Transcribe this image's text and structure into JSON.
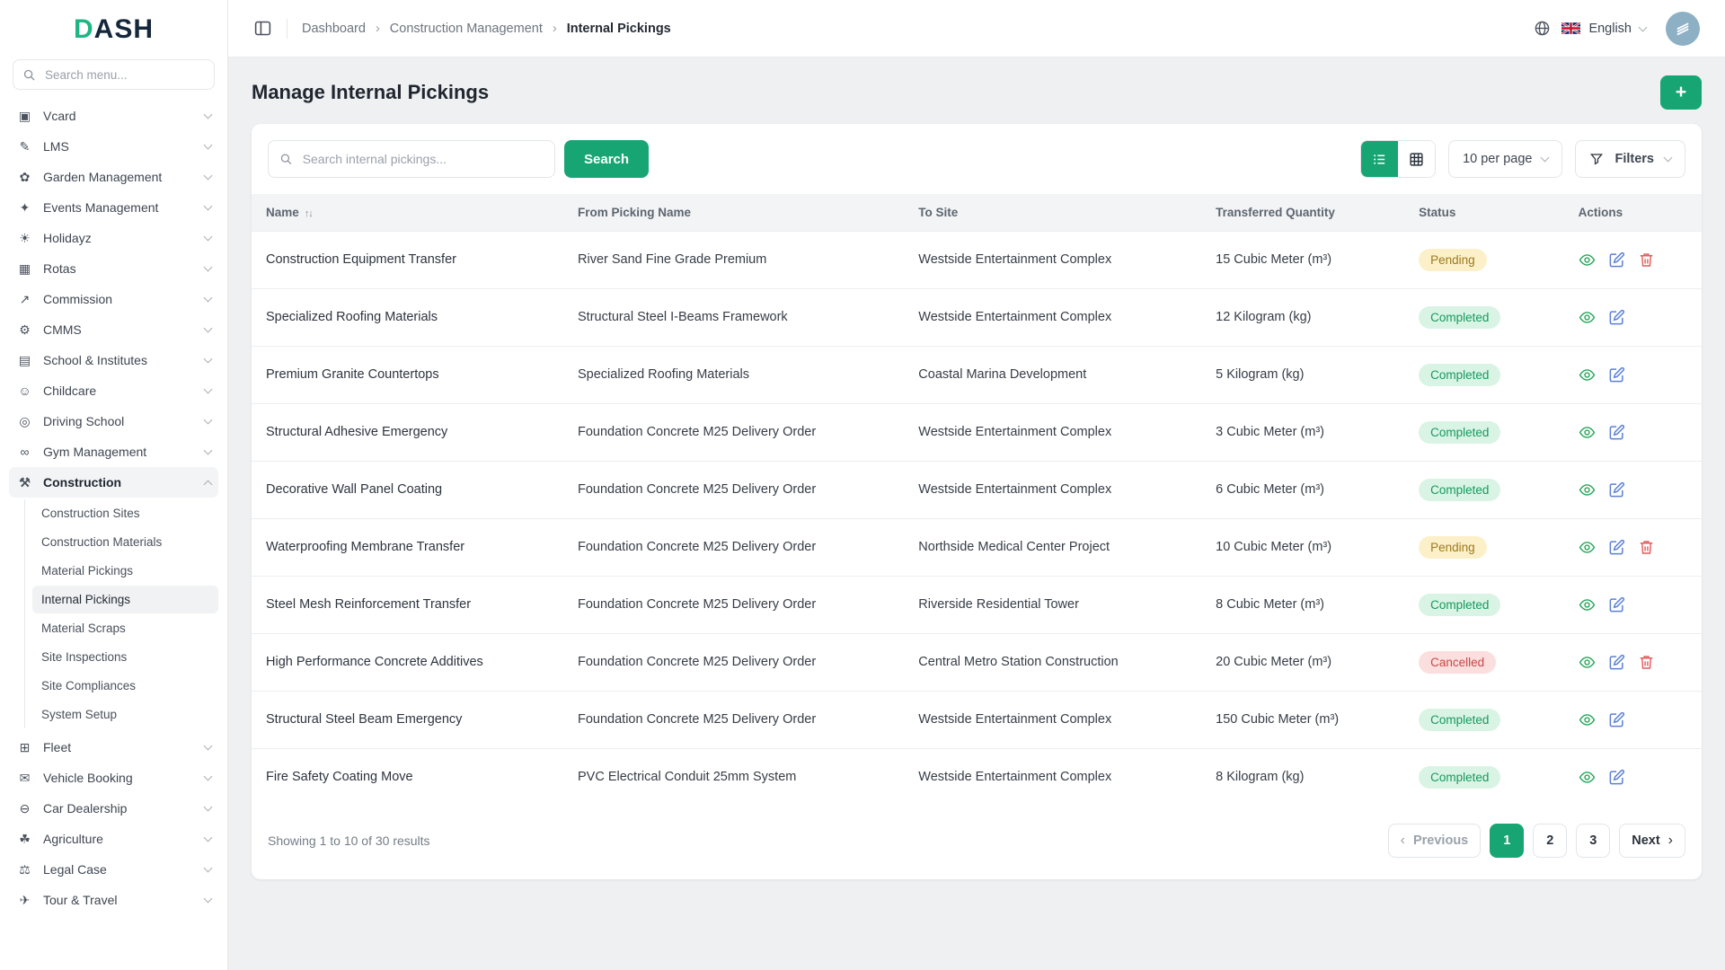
{
  "accent": "#17a673",
  "app": {
    "logo_first": "D",
    "logo_rest": "ASH"
  },
  "sidebar": {
    "search_placeholder": "Search menu...",
    "items": [
      {
        "label": "Vcard",
        "icon": "▣"
      },
      {
        "label": "LMS",
        "icon": "✎"
      },
      {
        "label": "Garden Management",
        "icon": "✿"
      },
      {
        "label": "Events Management",
        "icon": "✦"
      },
      {
        "label": "Holidayz",
        "icon": "☀"
      },
      {
        "label": "Rotas",
        "icon": "▦"
      },
      {
        "label": "Commission",
        "icon": "↗"
      },
      {
        "label": "CMMS",
        "icon": "⚙"
      },
      {
        "label": "School & Institutes",
        "icon": "▤"
      },
      {
        "label": "Childcare",
        "icon": "☺"
      },
      {
        "label": "Driving School",
        "icon": "◎"
      },
      {
        "label": "Gym Management",
        "icon": "∞"
      },
      {
        "label": "Construction",
        "icon": "⚒"
      },
      {
        "label": "Fleet",
        "icon": "⊞"
      },
      {
        "label": "Vehicle Booking",
        "icon": "✉"
      },
      {
        "label": "Car Dealership",
        "icon": "⊖"
      },
      {
        "label": "Agriculture",
        "icon": "☘"
      },
      {
        "label": "Legal Case",
        "icon": "⚖"
      },
      {
        "label": "Tour & Travel",
        "icon": "✈"
      }
    ],
    "construction_children": [
      {
        "label": "Construction Sites",
        "active": ""
      },
      {
        "label": "Construction Materials",
        "active": ""
      },
      {
        "label": "Material Pickings",
        "active": ""
      },
      {
        "label": "Internal Pickings",
        "active": "active"
      },
      {
        "label": "Material Scraps",
        "active": ""
      },
      {
        "label": "Site Inspections",
        "active": ""
      },
      {
        "label": "Site Compliances",
        "active": ""
      },
      {
        "label": "System Setup",
        "active": ""
      }
    ]
  },
  "topbar": {
    "breadcrumbs": [
      "Dashboard",
      "Construction Management",
      "Internal Pickings"
    ],
    "breadcrumb_separator": "›",
    "language": "English"
  },
  "page": {
    "title": "Manage Internal Pickings",
    "add_label": "+"
  },
  "toolbar": {
    "search_placeholder": "Search internal pickings...",
    "search_label": "Search",
    "per_page": "10 per page",
    "filters_label": "Filters"
  },
  "icons": {
    "sort": "↑↓"
  },
  "table": {
    "columns": [
      "Name",
      "From Picking Name",
      "To Site",
      "Transferred Quantity",
      "Status",
      "Actions"
    ],
    "rows": [
      {
        "name": "Construction Equipment Transfer",
        "from": "River Sand Fine Grade Premium",
        "to": "Westside Entertainment Complex",
        "qty": "15 Cubic Meter (m³)",
        "status": "Pending",
        "status_type": "pending",
        "can_delete": true
      },
      {
        "name": "Specialized Roofing Materials",
        "from": "Structural Steel I-Beams Framework",
        "to": "Westside Entertainment Complex",
        "qty": "12 Kilogram (kg)",
        "status": "Completed",
        "status_type": "completed",
        "can_delete": false
      },
      {
        "name": "Premium Granite Countertops",
        "from": "Specialized Roofing Materials",
        "to": "Coastal Marina Development",
        "qty": "5 Kilogram (kg)",
        "status": "Completed",
        "status_type": "completed",
        "can_delete": false
      },
      {
        "name": "Structural Adhesive Emergency",
        "from": "Foundation Concrete M25 Delivery Order",
        "to": "Westside Entertainment Complex",
        "qty": "3 Cubic Meter (m³)",
        "status": "Completed",
        "status_type": "completed",
        "can_delete": false
      },
      {
        "name": "Decorative Wall Panel Coating",
        "from": "Foundation Concrete M25 Delivery Order",
        "to": "Westside Entertainment Complex",
        "qty": "6 Cubic Meter (m³)",
        "status": "Completed",
        "status_type": "completed",
        "can_delete": false
      },
      {
        "name": "Waterproofing Membrane Transfer",
        "from": "Foundation Concrete M25 Delivery Order",
        "to": "Northside Medical Center Project",
        "qty": "10 Cubic Meter (m³)",
        "status": "Pending",
        "status_type": "pending",
        "can_delete": true
      },
      {
        "name": "Steel Mesh Reinforcement Transfer",
        "from": "Foundation Concrete M25 Delivery Order",
        "to": "Riverside Residential Tower",
        "qty": "8 Cubic Meter (m³)",
        "status": "Completed",
        "status_type": "completed",
        "can_delete": false
      },
      {
        "name": "High Performance Concrete Additives",
        "from": "Foundation Concrete M25 Delivery Order",
        "to": "Central Metro Station Construction",
        "qty": "20 Cubic Meter (m³)",
        "status": "Cancelled",
        "status_type": "cancelled",
        "can_delete": true
      },
      {
        "name": "Structural Steel Beam Emergency",
        "from": "Foundation Concrete M25 Delivery Order",
        "to": "Westside Entertainment Complex",
        "qty": "150 Cubic Meter (m³)",
        "status": "Completed",
        "status_type": "completed",
        "can_delete": false
      },
      {
        "name": "Fire Safety Coating Move",
        "from": "PVC Electrical Conduit 25mm System",
        "to": "Westside Entertainment Complex",
        "qty": "8 Kilogram (kg)",
        "status": "Completed",
        "status_type": "completed",
        "can_delete": false
      }
    ]
  },
  "footer": {
    "summary": "Showing 1 to 10 of 30 results",
    "previous": "Previous",
    "next": "Next",
    "prev_icon": "‹",
    "next_icon": "›",
    "pages": [
      {
        "label": "1",
        "active": "active"
      },
      {
        "label": "2",
        "active": ""
      },
      {
        "label": "3",
        "active": ""
      }
    ]
  }
}
